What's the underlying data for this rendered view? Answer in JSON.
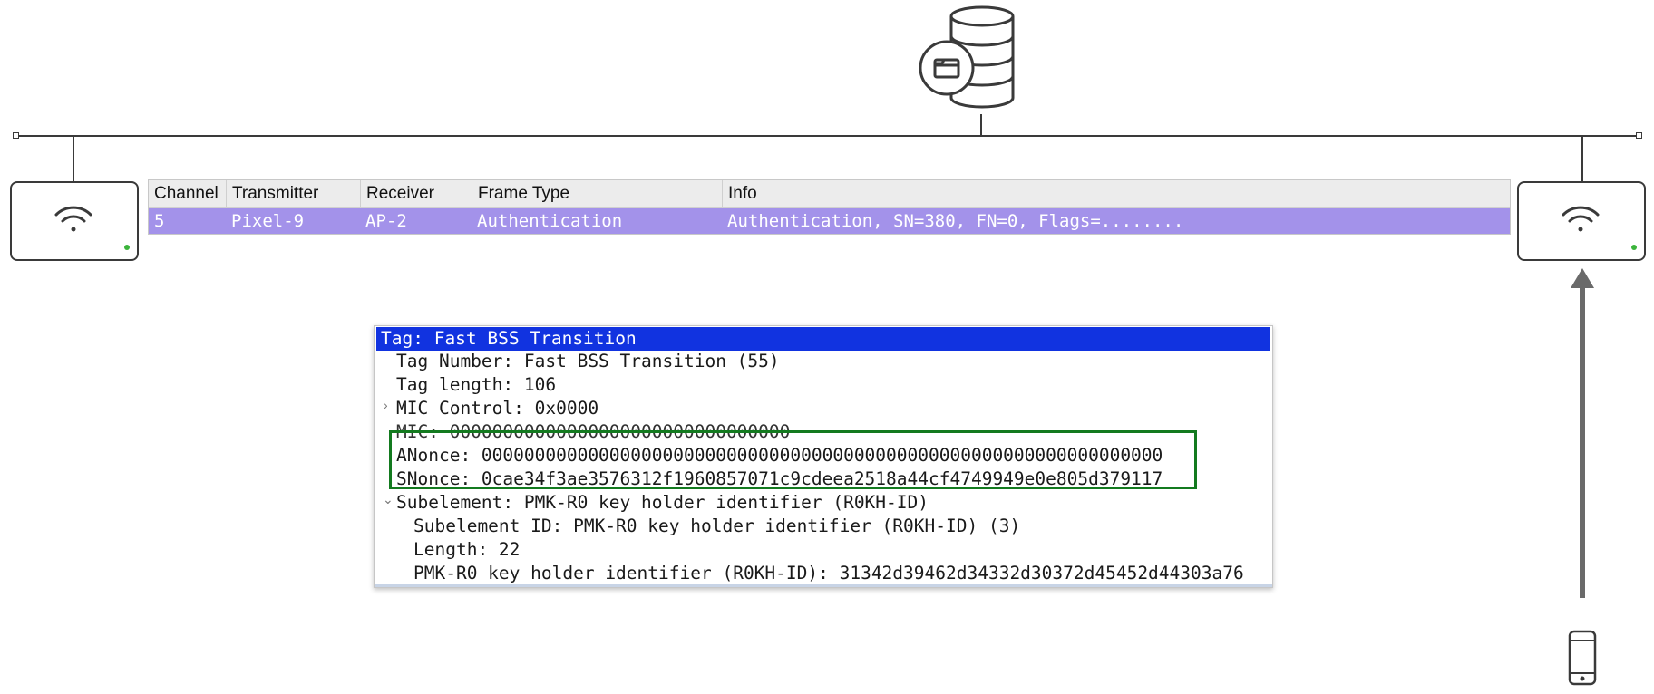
{
  "packet_list": {
    "columns": [
      "Channel",
      "Transmitter",
      "Receiver",
      "Frame Type",
      "Info"
    ],
    "selected_row": {
      "channel": "5",
      "transmitter": "Pixel-9",
      "receiver": "AP-2",
      "frame_type": "Authentication",
      "info": "Authentication, SN=380, FN=0, Flags=........"
    }
  },
  "detail": {
    "selected_line": "Tag: Fast BSS Transition",
    "lines": {
      "tag_number": "Tag Number: Fast BSS Transition (55)",
      "tag_length": "Tag length: 106",
      "mic_control": "MIC Control: 0x0000",
      "mic": "MIC: 00000000000000000000000000000000",
      "anonce": "ANonce: 0000000000000000000000000000000000000000000000000000000000000000",
      "snonce": "SNonce: 0cae34f3ae3576312f1960857071c9cdeea2518a44cf4749949e0e805d379117",
      "subelement": "Subelement: PMK-R0 key holder identifier (R0KH-ID)",
      "subelement_id": "Subelement ID: PMK-R0 key holder identifier (R0KH-ID) (3)",
      "length": "Length: 22",
      "r0kh_id": "PMK-R0 key holder identifier (R0KH-ID): 31342d39462d34332d30372d45452d44303a76"
    }
  },
  "icons": {
    "server": "database-server-icon",
    "ap_left": "wifi-access-point-icon",
    "ap_right": "wifi-access-point-icon",
    "phone": "smartphone-icon"
  },
  "colors": {
    "row_highlight": "#a392ea",
    "selected_line": "#1133e0",
    "highlight_box": "#137a1f",
    "led": "#3cb43c"
  }
}
